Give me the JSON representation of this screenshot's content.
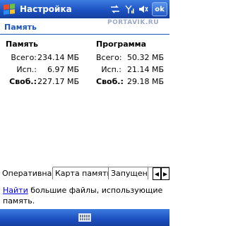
{
  "window": {
    "title": "Настройка",
    "ok_label": "ok",
    "watermark": "PORTAVIK.RU",
    "tray_icons": [
      "connectivity-icon",
      "signal-icon",
      "speaker-icon"
    ]
  },
  "page": {
    "title": "Память"
  },
  "memory": {
    "heading": "Память",
    "rows": [
      {
        "label": "Всего:",
        "value": "234.14 МБ"
      },
      {
        "label": "Исп.:",
        "value": "6.97 МБ"
      },
      {
        "label": "Своб.:",
        "value": "227.17 МБ"
      }
    ]
  },
  "program": {
    "heading": "Программа",
    "rows": [
      {
        "label": "Всего:",
        "value": "50.32 МБ"
      },
      {
        "label": "Исп.:",
        "value": "21.14 МБ"
      },
      {
        "label": "Своб.:",
        "value": "29.18 МБ"
      }
    ]
  },
  "tabs": [
    {
      "label": "Оперативная",
      "active": true
    },
    {
      "label": "Карта памяти",
      "active": false
    },
    {
      "label": "Запущенные",
      "active": false
    }
  ],
  "hint": {
    "link": "Найти",
    "text": " большие файлы, использующие память."
  },
  "bottombar": {
    "icon": "keyboard-icon"
  }
}
